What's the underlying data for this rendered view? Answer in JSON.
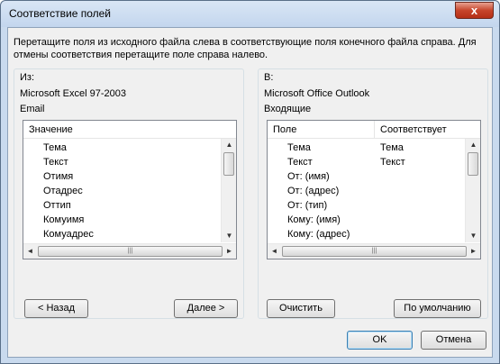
{
  "window": {
    "title": "Соответствие полей",
    "close_label": "x",
    "description": "Перетащите поля из исходного файла слева в соответствующие поля конечного файла справа.  Для отмены соответствия перетащите поле справа налево."
  },
  "left": {
    "from_label": "Из:",
    "app": "Microsoft Excel 97-2003",
    "item": "Email",
    "header": "Значение",
    "fields": [
      "Тема",
      "Текст",
      "Отимя",
      "Отадрес",
      "Оттип",
      "Комуимя",
      "Комуадрес"
    ],
    "back_label": "< Назад",
    "next_label": "Далее >"
  },
  "right": {
    "to_label": "В:",
    "app": "Microsoft Office Outlook",
    "item": "Входящие",
    "header_field": "Поле",
    "header_match": "Соответствует",
    "rows": [
      {
        "field": "Тема",
        "match": "Тема"
      },
      {
        "field": "Текст",
        "match": "Текст"
      },
      {
        "field": "От: (имя)",
        "match": ""
      },
      {
        "field": "От: (адрес)",
        "match": ""
      },
      {
        "field": "От: (тип)",
        "match": ""
      },
      {
        "field": "Кому: (имя)",
        "match": ""
      },
      {
        "field": "Кому: (адрес)",
        "match": ""
      }
    ],
    "clear_label": "Очистить",
    "default_label": "По умолчанию"
  },
  "footer": {
    "ok_label": "OK",
    "cancel_label": "Отмена"
  },
  "icons": {
    "up": "▲",
    "down": "▼",
    "left": "◄",
    "right": "►",
    "grip": "|||"
  }
}
